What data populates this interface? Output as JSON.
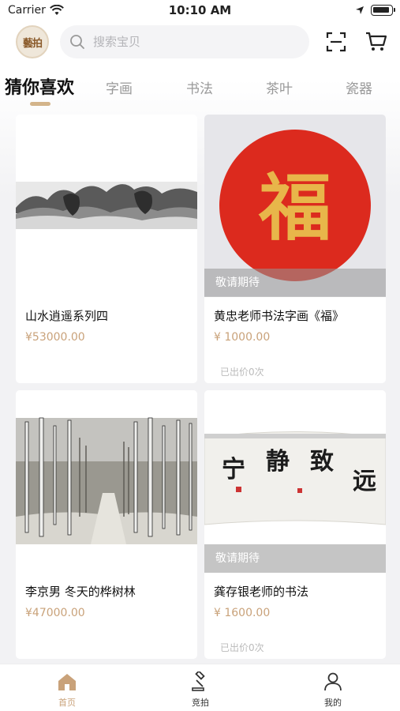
{
  "status_bar": {
    "carrier": "Carrier",
    "time": "10:10 AM"
  },
  "header": {
    "logo_text": "藝拍",
    "search_placeholder": "搜索宝贝",
    "icons": [
      "logo",
      "search-icon",
      "scan-icon",
      "cart-icon"
    ]
  },
  "tabs": [
    {
      "label": "猜你喜欢",
      "active": true
    },
    {
      "label": "字画",
      "active": false
    },
    {
      "label": "书法",
      "active": false
    },
    {
      "label": "茶叶",
      "active": false
    },
    {
      "label": "瓷器",
      "active": false
    }
  ],
  "colors": {
    "accent": "#d3b48a",
    "price": "#c9a27a",
    "seal_red": "#dc2a1e",
    "gold_text": "#e8b64a"
  },
  "products": [
    {
      "title": "山水逍遥系列四",
      "price": "¥53000.00",
      "badge": "",
      "bids": ""
    },
    {
      "title": "黄忠老师书法字画《福》",
      "price": "¥ 1000.00",
      "badge": "敬请期待",
      "bids": "已出价0次",
      "artwork_text": "福"
    },
    {
      "title": "李京男 冬天的桦树林",
      "price": "¥47000.00",
      "badge": "",
      "bids": ""
    },
    {
      "title": "龚存银老师的书法",
      "price": "¥ 1600.00",
      "badge": "敬请期待",
      "bids": "已出价0次",
      "artwork_text": "宁静致远"
    }
  ],
  "bottom_nav": [
    {
      "label": "首页",
      "icon": "home-icon",
      "active": true
    },
    {
      "label": "竞拍",
      "icon": "auction-hammer-icon",
      "active": false
    },
    {
      "label": "我的",
      "icon": "user-icon",
      "active": false
    }
  ]
}
